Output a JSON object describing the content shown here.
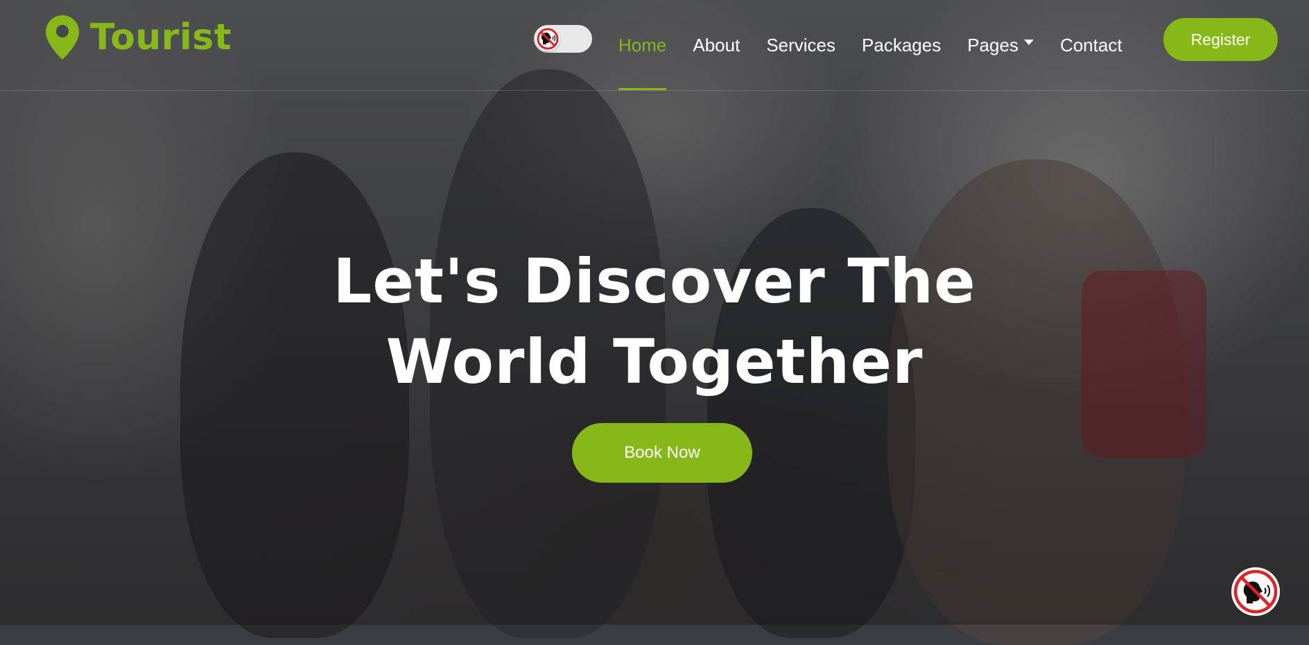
{
  "brand": {
    "name": "Tourist",
    "icon": "map-pin-icon",
    "color": "#86b817"
  },
  "nav": {
    "items": [
      {
        "label": "Home",
        "active": true
      },
      {
        "label": "About",
        "active": false
      },
      {
        "label": "Services",
        "active": false
      },
      {
        "label": "Packages",
        "active": false
      },
      {
        "label": "Pages",
        "active": false,
        "dropdown": true
      },
      {
        "label": "Contact",
        "active": false
      }
    ],
    "register_label": "Register",
    "theme_toggle_icon": "no-speak-icon"
  },
  "hero": {
    "title": "Let's Discover The World Together",
    "cta_label": "Book Now",
    "background": "group-of-hikers-laughing-mountains"
  },
  "floating": {
    "icon": "no-speak-icon",
    "accent": "#e32026"
  },
  "colors": {
    "accent": "#86b817",
    "text": "#ffffff"
  }
}
